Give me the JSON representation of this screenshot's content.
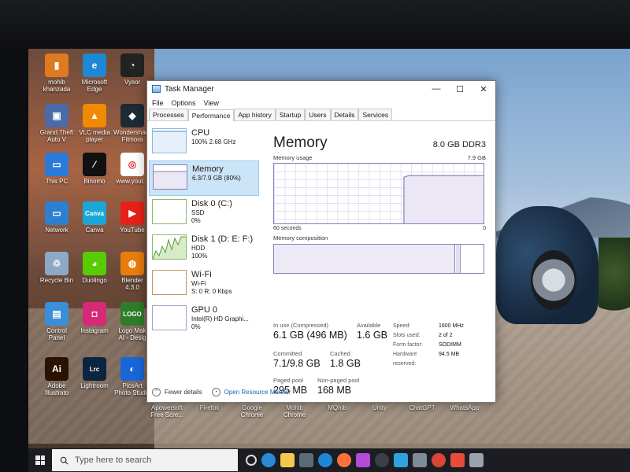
{
  "desktop": {
    "icons": [
      {
        "label": "mohib\nkhanzada",
        "color": "#e07a1f",
        "glyph": "▮"
      },
      {
        "label": "Microsoft\nEdge",
        "color": "#1e88d6",
        "glyph": "e"
      },
      {
        "label": "Vysor",
        "color": "#222222",
        "glyph": "◔"
      },
      {
        "label": "Grand Theft\nAuto V",
        "color": "#4a6aa8",
        "glyph": "▣"
      },
      {
        "label": "VLC media\nplayer",
        "color": "#f08a00",
        "glyph": "▲"
      },
      {
        "label": "Wondershare\nFilmora",
        "color": "#1c2b35",
        "glyph": "◆"
      },
      {
        "label": "This PC",
        "color": "#2a7ad8",
        "glyph": "▭"
      },
      {
        "label": "Binomo",
        "color": "#111111",
        "glyph": "⁄"
      },
      {
        "label": "www.yout...",
        "color": "#ffffff",
        "glyph": "◎"
      },
      {
        "label": "Network",
        "color": "#2d7fd0",
        "glyph": "▭"
      },
      {
        "label": "Canva",
        "color": "#1ba7d6",
        "glyph": "Canva"
      },
      {
        "label": "YouTube",
        "color": "#e62117",
        "glyph": "▶"
      },
      {
        "label": "Recycle Bin",
        "color": "#8da9c4",
        "glyph": "♲"
      },
      {
        "label": "Duolingo",
        "color": "#58cc02",
        "glyph": "◕"
      },
      {
        "label": "Blender\n4.3.0",
        "color": "#e87d0d",
        "glyph": "◍"
      },
      {
        "label": "Control\nPanel",
        "color": "#3a8fd8",
        "glyph": "▤"
      },
      {
        "label": "Instagram",
        "color": "#d62976",
        "glyph": "◘"
      },
      {
        "label": "Logo Mak\nAI - Desig",
        "color": "#2f7d2a",
        "glyph": "LOGO"
      },
      {
        "label": "Adobe\nIllustrato",
        "color": "#2b1200",
        "glyph": "Ai"
      },
      {
        "label": "Lightroom",
        "color": "#0b2540",
        "glyph": "Lrc"
      },
      {
        "label": "PicsArt\nPhoto Studio",
        "color": "#1a66d9",
        "glyph": "◐"
      }
    ],
    "bottom_labels": [
      "Apowersoft\nFree Scre...",
      "Firefox",
      "Google\nChrome",
      "Mohib\nChrome",
      "MQhib",
      "Unity",
      "ChatGPT",
      "WhatsApp"
    ]
  },
  "taskbar": {
    "search_placeholder": "Type here to search"
  },
  "window": {
    "title": "Task Manager",
    "controls": {
      "minimize": "—",
      "maximize": "☐",
      "close": "✕"
    },
    "menu": [
      "File",
      "Options",
      "View"
    ],
    "tabs": [
      "Processes",
      "Performance",
      "App history",
      "Startup",
      "Users",
      "Details",
      "Services"
    ],
    "active_tab": "Performance"
  },
  "sidebar": {
    "resources": [
      {
        "name": "CPU",
        "line1": "100% 2.68 GHz",
        "line2": ""
      },
      {
        "name": "Memory",
        "line1": "6.3/7.9 GB (80%)",
        "line2": ""
      },
      {
        "name": "Disk 0 (C:)",
        "line1": "SSD",
        "line2": "0%"
      },
      {
        "name": "Disk 1 (D: E: F:)",
        "line1": "HDD",
        "line2": "100%"
      },
      {
        "name": "Wi-Fi",
        "line1": "Wi-Fi",
        "line2": "S: 0 R: 0 Kbps"
      },
      {
        "name": "GPU 0",
        "line1": "Intel(R) HD Graphi...",
        "line2": "0%"
      }
    ]
  },
  "memory": {
    "title": "Memory",
    "spec": "8.0 GB DDR3",
    "usage_label": "Memory usage",
    "usage_max": "7.9 GB",
    "axis_left": "60 seconds",
    "axis_right": "0",
    "composition_label": "Memory composition",
    "composition_used_fraction": 0.8,
    "usage_recent_fraction": 0.8,
    "stats": {
      "in_use_label": "In use (Compressed)",
      "in_use_value": "6.1 GB (496 MB)",
      "available_label": "Available",
      "available_value": "1.6 GB",
      "committed_label": "Committed",
      "committed_value": "7.1/9.8 GB",
      "cached_label": "Cached",
      "cached_value": "1.8 GB",
      "paged_label": "Paged pool",
      "paged_value": "295 MB",
      "nonpaged_label": "Non-paged pool",
      "nonpaged_value": "168 MB"
    },
    "hardware": [
      {
        "k": "Speed:",
        "v": "1600 MHz"
      },
      {
        "k": "Slots used:",
        "v": "2 of 2"
      },
      {
        "k": "Form factor:",
        "v": "SODIMM"
      },
      {
        "k": "Hardware reserved:",
        "v": "94.5 MB"
      }
    ]
  },
  "footer": {
    "fewer_details": "Fewer details",
    "open_monitor": "Open Resource Monitor"
  },
  "colors": {
    "accent": "#8b7fb8",
    "selected_bg": "#cce4f7",
    "link": "#1b64b3"
  }
}
